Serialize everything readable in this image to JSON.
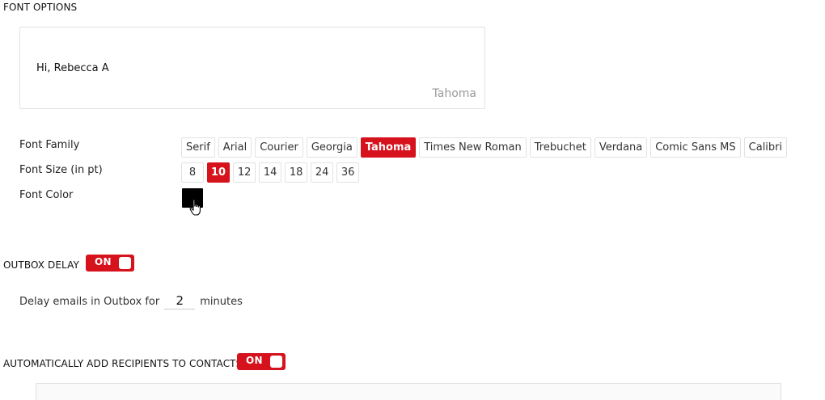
{
  "font_options": {
    "title": "FONT OPTIONS",
    "preview_text": "Hi, Rebecca A",
    "preview_font": "Tahoma",
    "family_label": "Font Family",
    "families": [
      "Serif",
      "Arial",
      "Courier",
      "Georgia",
      "Tahoma",
      "Times New Roman",
      "Trebuchet",
      "Verdana",
      "Comic Sans MS",
      "Calibri"
    ],
    "selected_family": "Tahoma",
    "size_label": "Font Size (in pt)",
    "sizes": [
      "8",
      "10",
      "12",
      "14",
      "18",
      "24",
      "36"
    ],
    "selected_size": "10",
    "color_label": "Font Color",
    "font_color": "#000000"
  },
  "outbox_delay": {
    "title": "OUTBOX DELAY",
    "toggle_label": "ON",
    "delay_prefix": "Delay emails in Outbox for",
    "delay_value": "2",
    "delay_suffix": "minutes"
  },
  "auto_add": {
    "title": "AUTOMATICALLY ADD RECIPIENTS TO CONTACTS",
    "toggle_label": "ON"
  },
  "colors": {
    "accent": "#d6121d",
    "border": "#e2e2e2"
  }
}
